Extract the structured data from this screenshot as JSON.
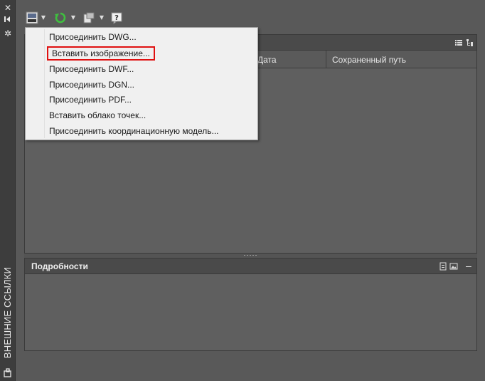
{
  "palette": {
    "title": "ВНЕШНИЕ ССЫЛКИ",
    "buttons": [
      "close-icon",
      "autohide-icon",
      "properties-icon"
    ]
  },
  "toolbar": {
    "buttons": [
      "attach-dwg-icon",
      "refresh-icon",
      "change-path-icon",
      "help-icon"
    ]
  },
  "file_refs": {
    "columns": [
      "Дата",
      "Сохраненный путь"
    ]
  },
  "details": {
    "title": "Подробности"
  },
  "attach_menu": {
    "items": [
      {
        "label": "Присоединить DWG..."
      },
      {
        "label": "Вставить изображение...",
        "highlighted": true
      },
      {
        "label": "Присоединить DWF..."
      },
      {
        "label": "Присоединить DGN..."
      },
      {
        "label": "Присоединить PDF..."
      },
      {
        "label": "Вставить облако точек..."
      },
      {
        "label": "Присоединить координационную модель..."
      }
    ]
  },
  "colors": {
    "background": "#595959",
    "menu_background": "#f0f0f0",
    "highlight_border": "#e01010",
    "refresh_green": "#3fbf3f"
  }
}
